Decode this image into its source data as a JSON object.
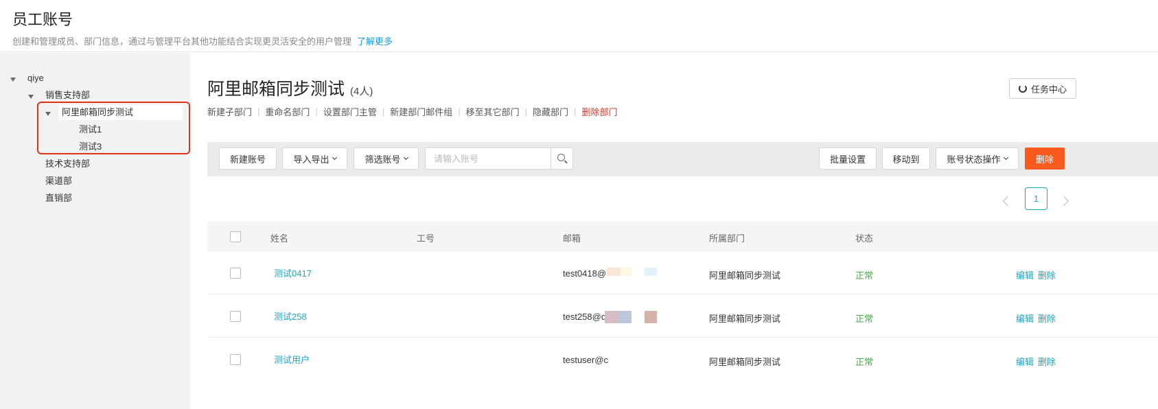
{
  "header": {
    "title": "员工账号",
    "description": "创建和管理成员、部门信息，通过与管理平台其他功能结合实现更灵活安全的用户管理",
    "learn_more": "了解更多"
  },
  "tree": {
    "root": "qiye",
    "dept_sales": "销售支持部",
    "dept_selected": "阿里邮箱同步测试",
    "child_1": "测试1",
    "child_3": "测试3",
    "dept_tech": "技术支持部",
    "dept_channel": "渠道部",
    "dept_direct": "直销部"
  },
  "department": {
    "name": "阿里邮箱同步测试",
    "count": "(4人)"
  },
  "task_center": "任务中心",
  "actions": {
    "new_sub": "新建子部门",
    "rename": "重命名部门",
    "set_manager": "设置部门主管",
    "new_mail_group": "新建部门邮件组",
    "move": "移至其它部门",
    "hide": "隐藏部门",
    "delete": "删除部门"
  },
  "toolbar": {
    "new_account": "新建账号",
    "import_export": "导入导出",
    "filter": "筛选账号",
    "search_placeholder": "请输入账号",
    "batch": "批量设置",
    "move_to": "移动到",
    "account_status": "账号状态操作",
    "delete": "删除"
  },
  "pagination": {
    "current": "1"
  },
  "table": {
    "columns": {
      "name": "姓名",
      "emp_no": "工号",
      "email": "邮箱",
      "dept": "所属部门",
      "status": "状态"
    },
    "rows": [
      {
        "name": "测试0417",
        "email": "test0418@",
        "dept": "阿里邮箱同步测试",
        "status": "正常",
        "edit": "编辑",
        "delete": "删除"
      },
      {
        "name": "测试258",
        "email": "test258@q",
        "dept": "阿里邮箱同步测试",
        "status": "正常",
        "edit": "编辑",
        "delete": "删除"
      },
      {
        "name": "测试用户",
        "email": "testuser@c",
        "dept": "阿里邮箱同步测试",
        "status": "正常",
        "edit": "编辑",
        "delete": "删除"
      }
    ]
  },
  "colors": {
    "accent": "#1aa6c9",
    "danger": "#e0301e",
    "delete_button": "#fa5a1e",
    "status_normal": "#4aab4a"
  }
}
